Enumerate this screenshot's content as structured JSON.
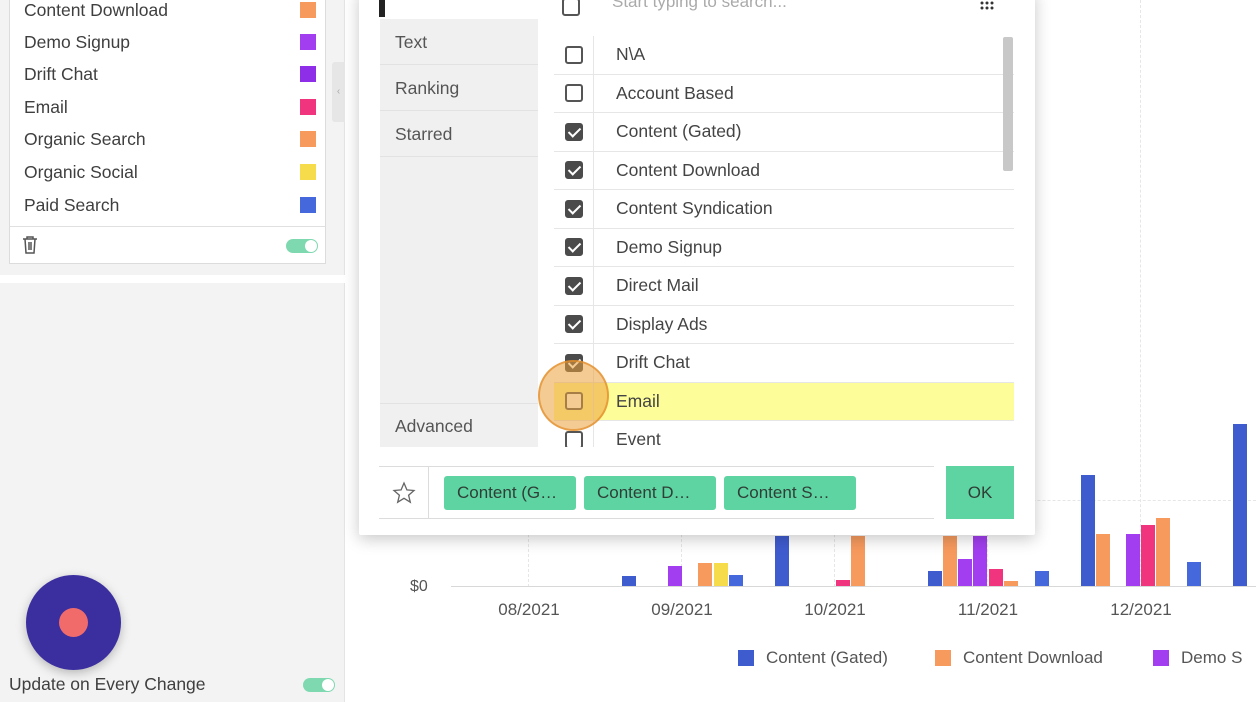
{
  "sidebar": {
    "legend_items": [
      {
        "label": "Content Download",
        "color": "#f79a5e"
      },
      {
        "label": "Demo Signup",
        "color": "#a23ef0"
      },
      {
        "label": "Drift Chat",
        "color": "#8e2ee8"
      },
      {
        "label": "Email",
        "color": "#f0357e"
      },
      {
        "label": "Organic Search",
        "color": "#f79a5e"
      },
      {
        "label": "Organic Social",
        "color": "#f6dc4a"
      },
      {
        "label": "Paid Search",
        "color": "#4568dc"
      }
    ],
    "trash_icon": "trash-icon",
    "update_label": "Update on Every Change",
    "update_toggle_on": true,
    "legend_toggle_on": true
  },
  "dialog": {
    "search_placeholder": "Start typing to search...",
    "categories": [
      "Text",
      "Ranking",
      "Starred"
    ],
    "advanced_label": "Advanced",
    "options": [
      {
        "label": "N\\A",
        "checked": false
      },
      {
        "label": "Account Based",
        "checked": false
      },
      {
        "label": "Content (Gated)",
        "checked": true
      },
      {
        "label": "Content Download",
        "checked": true
      },
      {
        "label": "Content Syndication",
        "checked": true
      },
      {
        "label": "Demo Signup",
        "checked": true
      },
      {
        "label": "Direct Mail",
        "checked": true
      },
      {
        "label": "Display Ads",
        "checked": true
      },
      {
        "label": "Drift Chat",
        "checked": true
      },
      {
        "label": "Email",
        "checked": false,
        "highlighted": true
      },
      {
        "label": "Event",
        "checked": false
      }
    ],
    "selected_chips": [
      "Content (G…",
      "Content D…",
      "Content S…"
    ],
    "ok_label": "OK",
    "star_icon": "star-icon"
  },
  "chart_data": {
    "type": "bar",
    "categories": [
      "08/2021",
      "09/2021",
      "10/2021",
      "11/2021",
      "12/2021"
    ],
    "y_tick_labels": [
      "$0"
    ],
    "series": [
      {
        "name": "Content (Gated)",
        "color": "#3f5ccf"
      },
      {
        "name": "Content Download",
        "color": "#f79a5e"
      },
      {
        "name": "Demo S",
        "color": "#a23ef0"
      }
    ],
    "colors": {
      "blue": "#3f5ccf",
      "orange": "#f79a5e",
      "purple": "#a23ef0",
      "pink": "#f0357e",
      "yellow": "#f6dc4a"
    }
  }
}
